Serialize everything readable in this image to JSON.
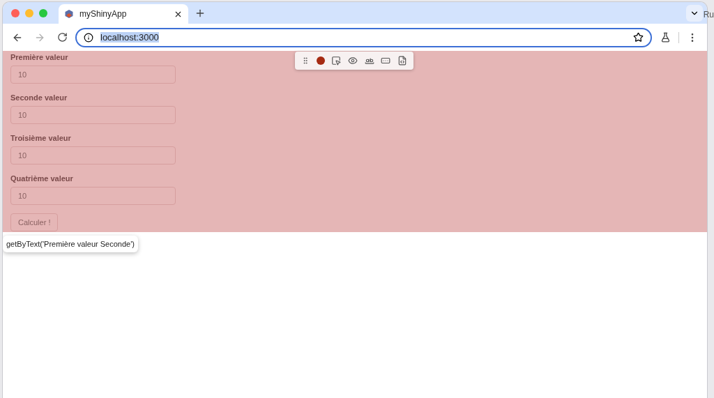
{
  "desktop_text": "Ru",
  "tab": {
    "title": "myShinyApp",
    "selected": true
  },
  "address": {
    "value": "localhost:3000",
    "selected": true
  },
  "form": {
    "fields": [
      {
        "label": "Première valeur",
        "value": "10"
      },
      {
        "label": "Seconde valeur",
        "value": "10"
      },
      {
        "label": "Troisième valeur",
        "value": "10"
      },
      {
        "label": "Quatrième valeur",
        "value": "10"
      }
    ],
    "button": "Calculer !",
    "highlighted": true
  },
  "tooltip": "getByText('Première valeur Seconde')"
}
